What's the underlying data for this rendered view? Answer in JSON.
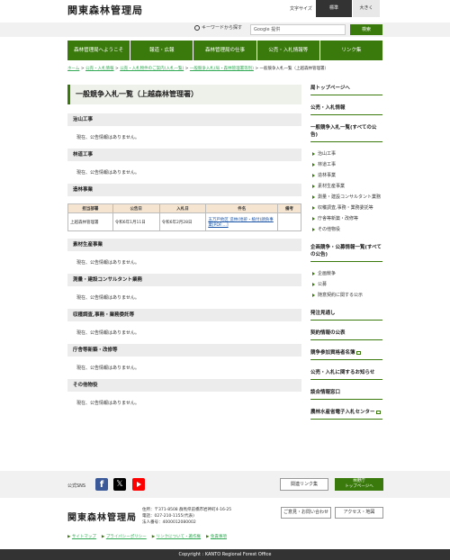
{
  "header": {
    "site_title": "関東森林管理局",
    "font_size_label": "文字サイズ",
    "font_size_standard": "標準",
    "font_size_large": "大きく"
  },
  "search": {
    "keyword_label": "キーワードから探す",
    "placeholder": "Google 提供",
    "button_label": "検索"
  },
  "global_nav": [
    "森林管理局へようこそ",
    "報道・広報",
    "森林管理局の仕事",
    "公売・入札情報等",
    "リンク集"
  ],
  "breadcrumb": {
    "items": [
      "ホーム",
      "公売・入札情報",
      "公売・入札物件のご案内(入札一覧)",
      "一般競争入札(局・森林管理署等別)"
    ],
    "current": "一般競争入札一覧（上越森林管理署）",
    "separator": ">"
  },
  "main": {
    "page_title": "一般競争入札一覧（上越森林管理署）",
    "no_info_text": "現在、公告情報はありません。",
    "sections": [
      {
        "title": "治山工事"
      },
      {
        "title": "林道工事"
      },
      {
        "title": "造林事業"
      },
      {
        "title": "素材生産事業"
      },
      {
        "title": "測量・建設コンサルタント業務"
      },
      {
        "title": "収穫調査,事務・業務委託等"
      },
      {
        "title": "庁舎等新築・改修等"
      },
      {
        "title": "その他物役"
      }
    ],
    "table": {
      "headers": [
        "担当部署",
        "公告日",
        "入札日",
        "件名",
        "備考"
      ],
      "rows": [
        {
          "dept": "上越森林管理署",
          "notice_date": "令和6年1月11日",
          "bid_date": "令和6年2月28日",
          "subject": "五万戸他区 造林(地拵・植付)請負事業[PDF:...]",
          "note": ""
        }
      ]
    }
  },
  "sidebar": {
    "top_link": "局トップページへ",
    "bidding_info": "公売・入札情報",
    "all_notice_link": "一般競争入札一覧(すべての公告)",
    "all_notice_items": [
      "治山工事",
      "林道工事",
      "造林事業",
      "素材生産事業",
      "測量・建設コンサルタント業務",
      "収穫調査,事務・業務委託等",
      "庁舎等新築・改修等",
      "その他物役"
    ],
    "proposal_link": "企画競争・公募情報一覧(すべての公告)",
    "proposal_items": [
      "企画競争",
      "公募",
      "随意契約に関する公示"
    ],
    "order_forecast": "発注見通し",
    "contract_info": "契約情報の公表",
    "qualified_list": "競争参加資格者名簿",
    "bidding_notice": "公売・入札に関するお知らせ",
    "contact_window": "談合情報窓口",
    "maff_link": "農林水産省電子入札センター"
  },
  "footer": {
    "sns_label": "公式SNS",
    "links_button": "関連リンク集",
    "forestry_agency_button": "林野庁\nトップページへ",
    "footer_title": "関東森林管理局",
    "address_lines": [
      "住所：〒371-8508 群馬県前橋市岩神町4-16-25",
      "電話：027-210-1155(代表)",
      "法人番号：4000012080002"
    ],
    "contact_button": "ご意見・お問い合わせ",
    "access_button": "アクセス・地図",
    "bottom_links": [
      "サイトマップ",
      "プライバシーポリシー",
      "リンクについて・著作権",
      "免責事項"
    ],
    "copyright": "Copyright : KANTO Regional Forest Office"
  },
  "colors": {
    "accent_green": "#3a7a0d",
    "table_header": "#f5e4cf"
  }
}
